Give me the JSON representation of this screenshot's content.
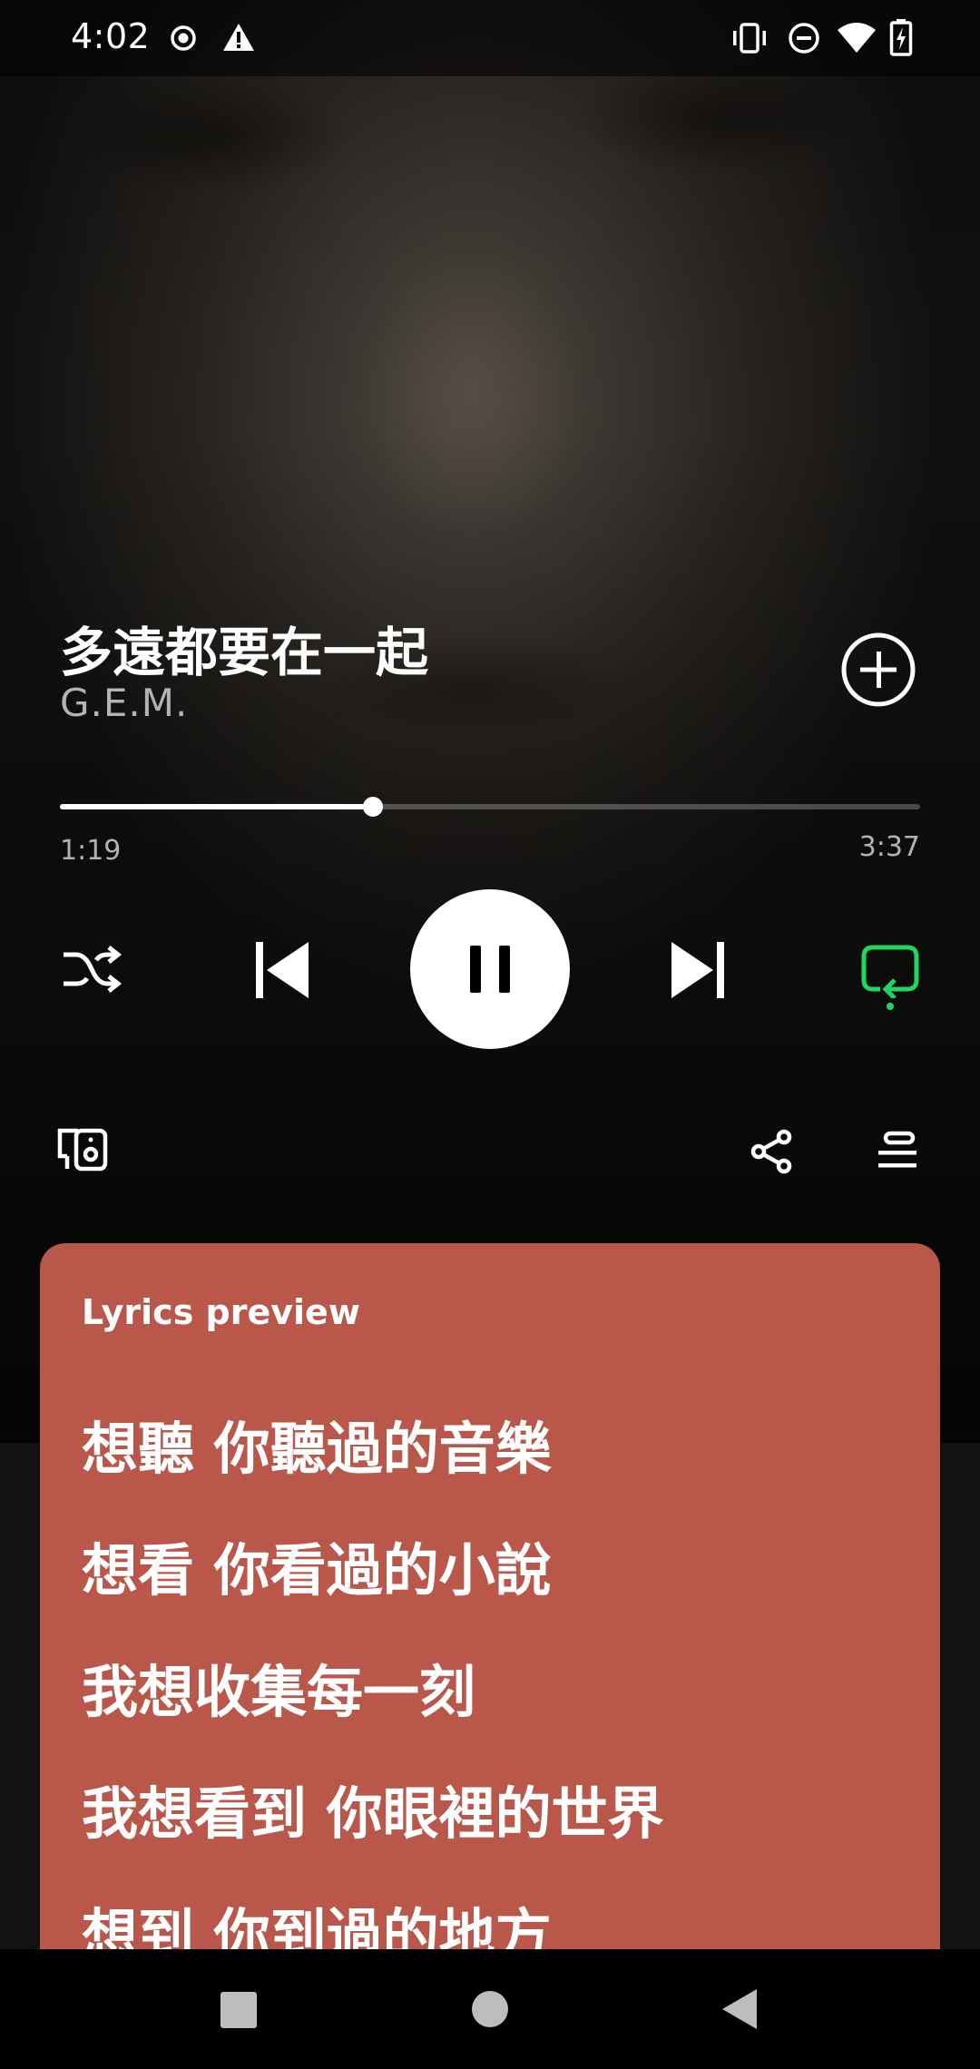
{
  "status_bar": {
    "time": "4:02",
    "left_icons": [
      "record-icon",
      "alert-triangle-icon"
    ],
    "right_icons": [
      "vibrate-icon",
      "do-not-disturb-icon",
      "wifi-icon",
      "battery-charging-icon"
    ]
  },
  "track": {
    "title": "多遠都要在一起",
    "artist": "G.E.M."
  },
  "playback": {
    "elapsed": "1:19",
    "total": "3:37",
    "progress_fraction": 0.364,
    "state": "playing",
    "repeat_active": true
  },
  "colors": {
    "accent_green": "#1ed760",
    "lyrics_card": "#ba574b",
    "background": "#121212"
  },
  "lyrics": {
    "title": "Lyrics preview",
    "lines": [
      "想聽 你聽過的音樂",
      "想看 你看過的小說",
      "我想收集每一刻",
      "我想看到 你眼裡的世界",
      "想到 你到過的地方"
    ]
  }
}
